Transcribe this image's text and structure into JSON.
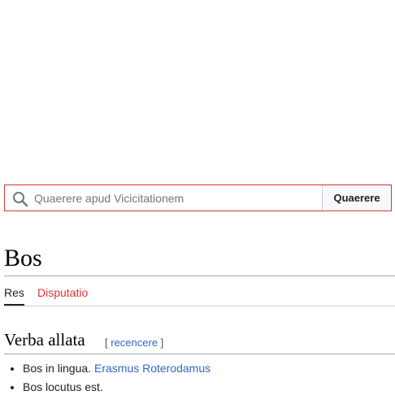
{
  "search": {
    "placeholder": "Quaerere apud Vicicitationem",
    "button_label": "Quaerere"
  },
  "page": {
    "title": "Bos"
  },
  "tabs": [
    {
      "label": "Res"
    },
    {
      "label": "Disputatio"
    }
  ],
  "section": {
    "title": "Verba allata",
    "edit_open": "[ ",
    "edit_label": "recencere",
    "edit_close": " ]"
  },
  "quotes": [
    {
      "text": "Bos in lingua. ",
      "link": "Erasmus Roterodamus"
    },
    {
      "text": "Bos locutus est.",
      "link": ""
    }
  ],
  "colors": {
    "search_border": "#dd3333",
    "link": "#3366cc",
    "missing_link": "#dd3333"
  },
  "icons": {
    "search": "search-icon"
  }
}
